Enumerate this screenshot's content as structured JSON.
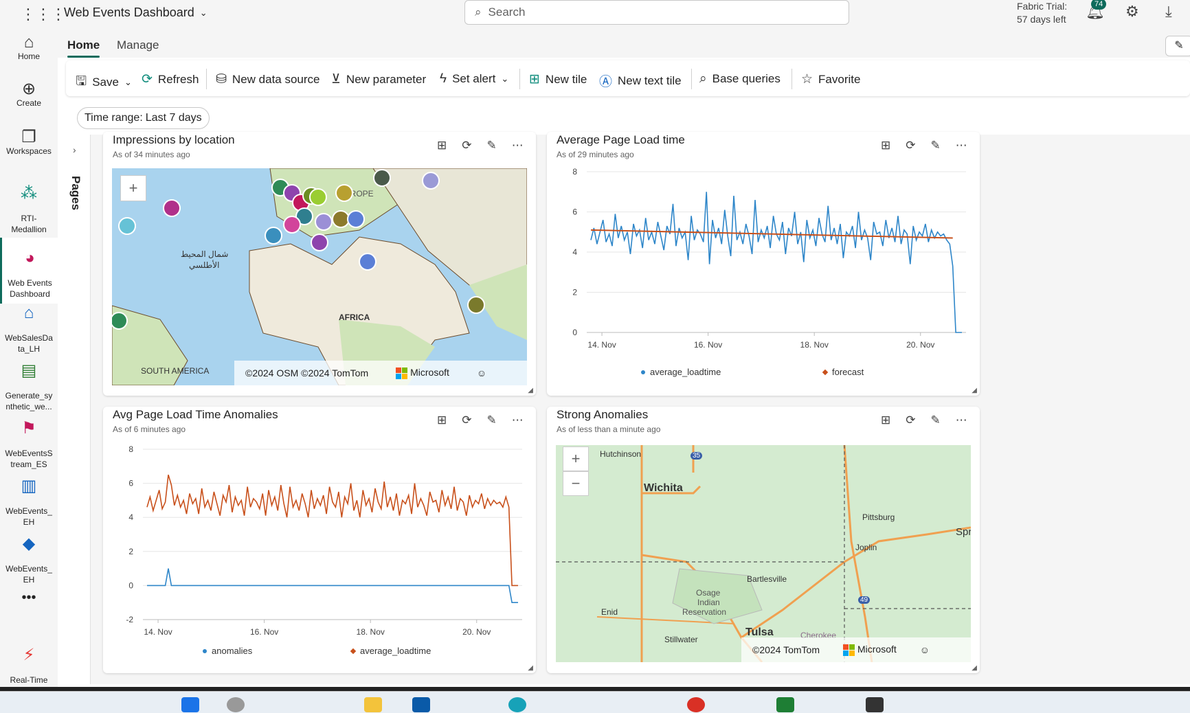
{
  "app": {
    "title": "Web Events Dashboard",
    "search_placeholder": "Search",
    "trial_line1": "Fabric Trial:",
    "trial_line2": "57 days left",
    "notifications": "74"
  },
  "rail": [
    {
      "label": "Home",
      "icon": "home-icon"
    },
    {
      "label": "Create",
      "icon": "create-icon"
    },
    {
      "label": "Workspaces",
      "icon": "workspaces-icon"
    },
    {
      "label": "RTI-\nMedallion",
      "icon": "rti-icon"
    },
    {
      "label": "Web Events\nDashboard",
      "icon": "dashboard-icon"
    },
    {
      "label": "WebSalesDa\nta_LH",
      "icon": "lakehouse-icon"
    },
    {
      "label": "Generate_sy\nnthetic_we...",
      "icon": "notebook-icon"
    },
    {
      "label": "WebEventsS\ntream_ES",
      "icon": "eventstream-icon"
    },
    {
      "label": "WebEvents_\nEH",
      "icon": "eventhouse-icon"
    },
    {
      "label": "WebEvents_\nEH",
      "icon": "kql-icon"
    },
    {
      "label": "Real-Time\nIntelligence",
      "icon": "rti-logo-icon"
    }
  ],
  "tabs": {
    "home": "Home",
    "manage": "Manage"
  },
  "toolbar": {
    "save": "Save",
    "refresh": "Refresh",
    "new_data_source": "New data source",
    "new_parameter": "New parameter",
    "set_alert": "Set alert",
    "new_tile": "New tile",
    "new_text_tile": "New text tile",
    "base_queries": "Base queries",
    "favorite": "Favorite"
  },
  "time_range": {
    "label": "Time range:",
    "value": "Last 7 days"
  },
  "pages_label": "Pages",
  "tiles": {
    "impressions": {
      "title": "Impressions by location",
      "subtitle": "As of 34 minutes ago",
      "map_labels": [
        "شمال المحيط",
        "الأطلسي",
        "AFRICA",
        "SOUTH AMERICA",
        "EUROPE"
      ],
      "attribution": "©2024 OSM  ©2024 TomTom",
      "brand": "Microsoft"
    },
    "load_time": {
      "title": "Average Page Load time",
      "subtitle": "As of 29 minutes ago"
    },
    "anomalies": {
      "title": "Avg Page Load Time Anomalies",
      "subtitle": "As of 6 minutes ago"
    },
    "strong": {
      "title": "Strong Anomalies",
      "subtitle": "As of less than a minute ago",
      "map_labels": [
        "Hutchinson",
        "Wichita",
        "Pittsburg",
        "Joplin",
        "Spri",
        "Bartlesville",
        "Osage",
        "Indian",
        "Reservation",
        "Enid",
        "Tulsa",
        "Stillwater",
        "Cherokee",
        "35",
        "49"
      ],
      "attribution": "©2024 TomTom",
      "brand": "Microsoft"
    }
  },
  "chart_data": [
    {
      "type": "line",
      "title": "Average Page Load time",
      "x_ticks": [
        "14. Nov",
        "16. Nov",
        "18. Nov",
        "20. Nov"
      ],
      "ylim": [
        0,
        8
      ],
      "y_ticks": [
        0,
        2,
        4,
        6,
        8
      ],
      "series": [
        {
          "name": "average_loadtime",
          "color": "#2e86c9",
          "values": [
            4.6,
            5.2,
            4.4,
            5.0,
            5.6,
            4.5,
            4.9,
            4.3,
            5.9,
            4.7,
            5.3,
            4.6,
            5.0,
            3.9,
            5.4,
            4.8,
            5.1,
            4.2,
            5.7,
            4.6,
            5.0,
            4.4,
            5.5,
            4.8,
            4.1,
            5.3,
            4.9,
            6.4,
            4.3,
            5.2,
            4.7,
            5.0,
            3.6,
            5.8,
            4.6,
            5.1,
            4.9,
            4.5,
            7.0,
            3.4,
            5.6,
            4.7,
            5.2,
            4.4,
            6.1,
            4.8,
            3.8,
            6.8,
            4.6,
            5.0,
            4.4,
            5.4,
            4.8,
            3.9,
            6.6,
            4.5,
            5.1,
            4.7,
            5.3,
            4.2,
            5.8,
            4.9,
            4.6,
            5.5,
            3.9,
            5.2,
            4.8,
            6.0,
            4.4,
            5.0,
            3.5,
            5.6,
            4.7,
            5.1,
            4.3,
            5.7,
            4.9,
            4.5,
            6.3,
            4.6,
            5.2,
            4.4,
            5.4,
            3.7,
            5.0,
            4.8,
            5.3,
            4.2,
            6.0,
            4.6,
            5.1,
            4.7,
            3.6,
            5.5,
            4.9,
            5.0,
            4.3,
            5.6,
            4.7,
            5.2,
            4.5,
            5.8,
            4.4,
            5.1,
            4.9,
            3.4,
            5.3,
            4.6,
            5.0,
            4.8,
            5.4,
            4.5,
            5.1,
            4.7,
            5.0,
            4.8,
            4.9,
            4.6,
            4.4,
            3.3,
            0.0,
            0.0,
            0.0
          ]
        },
        {
          "name": "forecast",
          "color": "#c8501b",
          "start": 5.1,
          "end": 4.7
        }
      ]
    },
    {
      "type": "line",
      "title": "Avg Page Load Time Anomalies",
      "x_ticks": [
        "14. Nov",
        "16. Nov",
        "18. Nov",
        "20. Nov"
      ],
      "ylim": [
        -2,
        8
      ],
      "y_ticks": [
        -2,
        0,
        2,
        4,
        6,
        8
      ],
      "series": [
        {
          "name": "anomalies",
          "color": "#2e86c9",
          "values": [
            0,
            0,
            0,
            0,
            0,
            0,
            0,
            1.0,
            0,
            0,
            0,
            0,
            0,
            0,
            0,
            0,
            0,
            0,
            0,
            0,
            0,
            0,
            0,
            0,
            0,
            0,
            0,
            0,
            0,
            0,
            0,
            0,
            0,
            0,
            0,
            0,
            0,
            0,
            0,
            0,
            0,
            0,
            0,
            0,
            0,
            0,
            0,
            0,
            0,
            0,
            0,
            0,
            0,
            0,
            0,
            0,
            0,
            0,
            0,
            0,
            0,
            0,
            0,
            0,
            0,
            0,
            0,
            0,
            0,
            0,
            0,
            0,
            0,
            0,
            0,
            0,
            0,
            0,
            0,
            0,
            0,
            0,
            0,
            0,
            0,
            0,
            0,
            0,
            0,
            0,
            0,
            0,
            0,
            0,
            0,
            0,
            0,
            0,
            0,
            0,
            0,
            0,
            0,
            0,
            0,
            0,
            0,
            0,
            0,
            0,
            0,
            0,
            0,
            0,
            0,
            0,
            0,
            0,
            0,
            0,
            -1.0,
            -1.0,
            -1.0
          ]
        },
        {
          "name": "average_loadtime",
          "color": "#c8501b",
          "values": [
            4.6,
            5.2,
            4.4,
            5.0,
            5.6,
            4.5,
            4.9,
            6.5,
            5.9,
            4.7,
            5.3,
            4.6,
            5.0,
            4.2,
            5.4,
            4.8,
            5.1,
            4.2,
            5.7,
            4.6,
            5.0,
            4.4,
            5.5,
            4.8,
            4.1,
            5.3,
            4.9,
            5.9,
            4.3,
            5.2,
            4.7,
            5.0,
            4.1,
            5.8,
            4.6,
            5.1,
            4.9,
            4.5,
            5.4,
            4.1,
            5.6,
            4.7,
            5.2,
            4.4,
            5.9,
            4.8,
            4.0,
            5.8,
            4.6,
            5.0,
            4.4,
            5.4,
            4.8,
            4.0,
            5.6,
            4.5,
            5.1,
            4.7,
            5.3,
            4.2,
            5.8,
            4.9,
            4.6,
            5.5,
            4.0,
            5.2,
            4.8,
            6.0,
            4.4,
            5.0,
            4.0,
            5.6,
            4.7,
            5.1,
            4.3,
            5.7,
            4.9,
            4.5,
            6.1,
            4.6,
            5.2,
            4.4,
            5.4,
            4.1,
            5.0,
            4.8,
            5.3,
            4.2,
            6.0,
            4.6,
            5.1,
            4.7,
            4.1,
            5.5,
            4.9,
            5.0,
            4.3,
            5.6,
            4.7,
            5.2,
            4.5,
            5.8,
            4.4,
            5.1,
            4.9,
            4.1,
            5.3,
            4.6,
            5.0,
            4.8,
            5.4,
            4.5,
            5.1,
            4.7,
            5.0,
            4.8,
            4.9,
            4.6,
            5.2,
            4.6,
            0.0,
            0.0,
            0.0
          ]
        }
      ]
    }
  ]
}
